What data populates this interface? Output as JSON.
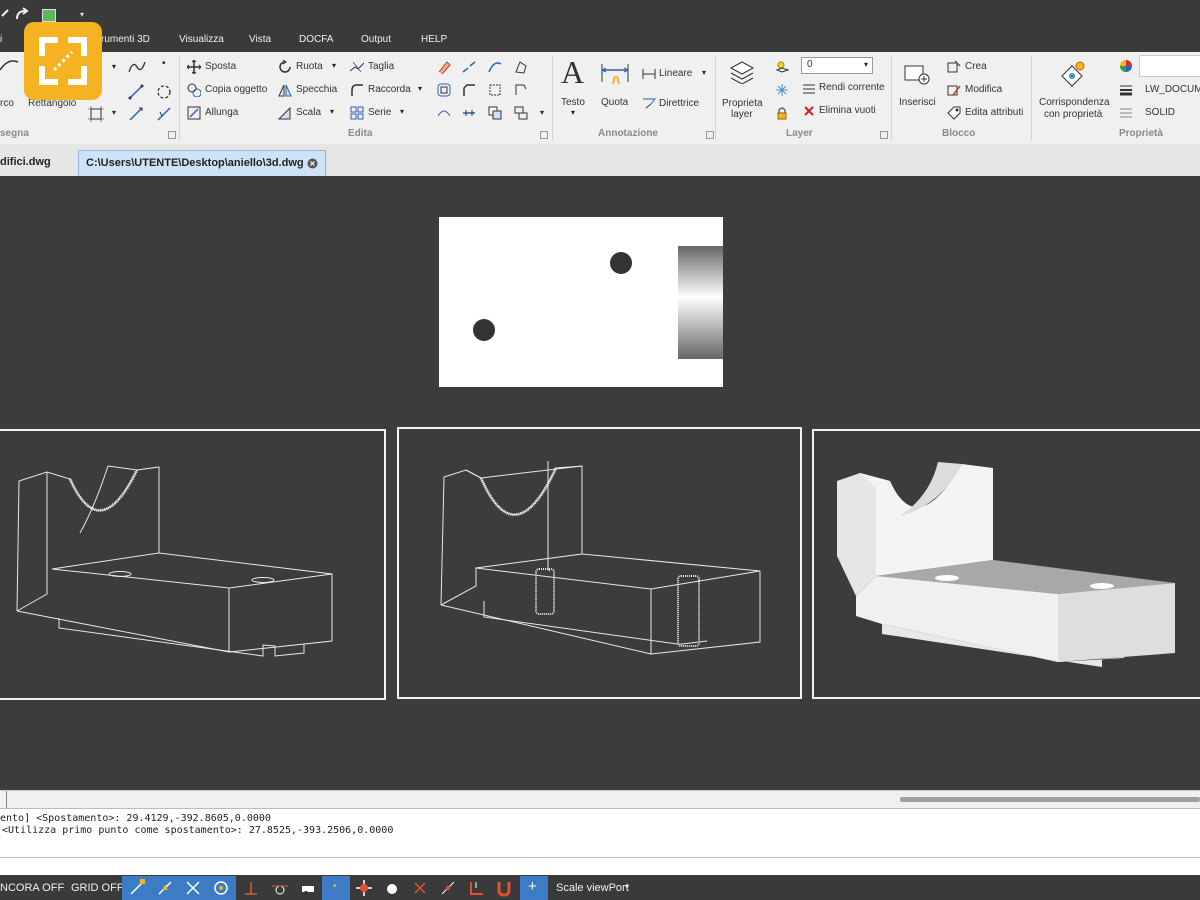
{
  "quick_access": {
    "redo_icon": "redo-icon"
  },
  "app_logo": {
    "name": "expand-logo-icon"
  },
  "menu": {
    "items": [
      "rumenti 3D",
      "Visualizza",
      "Vista",
      "DOCFA",
      "Output",
      "HELP"
    ],
    "first_fragment": "i"
  },
  "ribbon": {
    "disegna": {
      "label": "segna",
      "arco": "rco",
      "rettangolo": "Rettangolo"
    },
    "edita": {
      "label": "Edita",
      "sposta": "Sposta",
      "copia": "Copia oggetto",
      "allunga": "Allunga",
      "ruota": "Ruota",
      "specchia": "Specchia",
      "scala": "Scala",
      "taglia": "Taglia",
      "raccorda": "Raccorda",
      "serie": "Serie"
    },
    "annotazione": {
      "label": "Annotazione",
      "testo": "Testo",
      "quota": "Quota",
      "lineare": "Lineare",
      "direttrice": "Direttrice"
    },
    "layer": {
      "label": "Layer",
      "proprieta": "Proprieta",
      "proprieta2": "layer",
      "current_value": "0",
      "rendi": "Rendi corrente",
      "elimina": "Elimina vuoti"
    },
    "blocco": {
      "label": "Blocco",
      "inserisci": "Inserisci",
      "crea": "Crea",
      "modifica": "Modifica",
      "edita_attr": "Edita attributi"
    },
    "proprieta": {
      "label": "Proprietà",
      "corr1": "Corrispondenza",
      "corr2": "con proprietà",
      "lineweight": "LW_DOCUME",
      "linetype": "SOLID"
    }
  },
  "tabs": [
    {
      "label": "difici.dwg",
      "active": false
    },
    {
      "label": "C:\\Users\\UTENTE\\Desktop\\aniello\\3d.dwg",
      "active": true
    }
  ],
  "command_history": [
    "ento] <Spostamento>: 29.4129,-392.8605,0.0000",
    "<Utilizza primo punto come spostamento>: 27.8525,-393.2506,0.0000"
  ],
  "status": {
    "ancora": "NCORA OFF",
    "grid": "GRID OFF",
    "scale": "Scale viewPort"
  },
  "colors": {
    "accent": "#f5b323",
    "active_tab": "#cfe3f7",
    "status_blue": "#3d7bc4"
  }
}
